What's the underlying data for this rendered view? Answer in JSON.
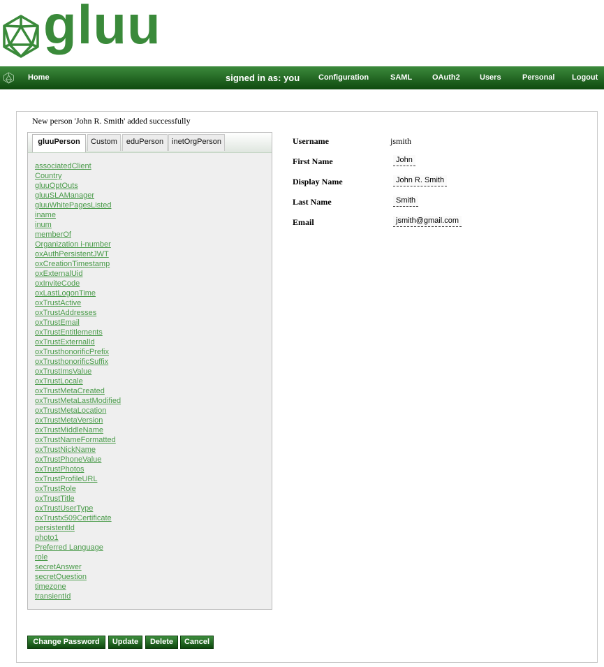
{
  "brand": {
    "logo_text": "gluu"
  },
  "nav": {
    "home": "Home",
    "signed_in": "signed in as: you",
    "items": [
      "Configuration",
      "SAML",
      "OAuth2",
      "Users",
      "Personal",
      "Logout"
    ]
  },
  "message": "New person 'John R. Smith' added successfully",
  "tabs": [
    "gluuPerson",
    "Custom",
    "eduPerson",
    "inetOrgPerson"
  ],
  "active_tab": "gluuPerson",
  "attributes": [
    "associatedClient",
    "Country",
    "gluuOptOuts",
    "gluuSLAManager",
    "gluuWhitePagesListed",
    "iname",
    "inum",
    "memberOf",
    "Organization i-number",
    "oxAuthPersistentJWT",
    "oxCreationTimestamp",
    "oxExternalUid",
    "oxInviteCode",
    "oxLastLogonTime",
    "oxTrustActive",
    "oxTrustAddresses",
    "oxTrustEmail",
    "oxTrustEntitlements",
    "oxTrustExternalId",
    "oxTrusthonorificPrefix",
    "oxTrusthonorificSuffix",
    "oxTrustImsValue",
    "oxTrustLocale",
    "oxTrustMetaCreated",
    "oxTrustMetaLastModified",
    "oxTrustMetaLocation",
    "oxTrustMetaVersion",
    "oxTrustMiddleName",
    "oxTrustNameFormatted",
    "oxTrustNickName",
    "oxTrustPhoneValue",
    "oxTrustPhotos",
    "oxTrustProfileURL",
    "oxTrustRole",
    "oxTrustTitle",
    "oxTrustUserType",
    "oxTrustx509Certificate",
    "persistentId",
    "photo1",
    "Preferred Language",
    "role",
    "secretAnswer",
    "secretQuestion",
    "timezone",
    "transientId"
  ],
  "form": {
    "username_label": "Username",
    "username_value": "jsmith",
    "firstname_label": "First Name",
    "firstname_value": "John",
    "displayname_label": "Display Name",
    "displayname_value": "John R. Smith",
    "lastname_label": "Last Name",
    "lastname_value": "Smith",
    "email_label": "Email",
    "email_value": "jsmith@gmail.com"
  },
  "buttons": {
    "change_password": "Change Password",
    "update": "Update",
    "delete": "Delete",
    "cancel": "Cancel"
  },
  "colors": {
    "brand_green": "#3a8a3a",
    "nav_dark": "#0f4a0f",
    "link_green": "#4a9b4a"
  }
}
